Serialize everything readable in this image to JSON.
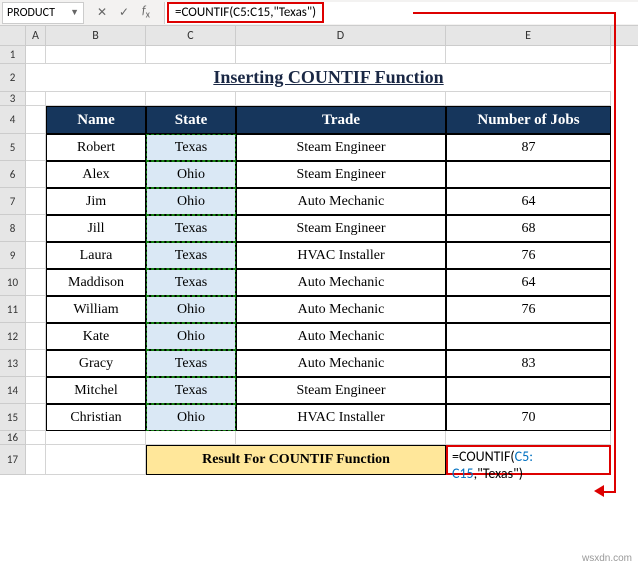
{
  "name_box": "PRODUCT",
  "formula_bar": "=COUNTIF(C5:C15,\"Texas\")",
  "columns": [
    "A",
    "B",
    "C",
    "D",
    "E"
  ],
  "row_numbers": [
    "1",
    "2",
    "3",
    "4",
    "5",
    "6",
    "7",
    "8",
    "9",
    "10",
    "11",
    "12",
    "13",
    "14",
    "15",
    "16",
    "17"
  ],
  "title": "Inserting COUNTIF Function",
  "headers": {
    "name": "Name",
    "state": "State",
    "trade": "Trade",
    "jobs": "Number of Jobs"
  },
  "rows": [
    {
      "name": "Robert",
      "state": "Texas",
      "trade": "Steam Engineer",
      "jobs": "87"
    },
    {
      "name": "Alex",
      "state": "Ohio",
      "trade": "Steam Engineer",
      "jobs": ""
    },
    {
      "name": "Jim",
      "state": "Ohio",
      "trade": "Auto Mechanic",
      "jobs": "64"
    },
    {
      "name": "Jill",
      "state": "Texas",
      "trade": "Steam Engineer",
      "jobs": "68"
    },
    {
      "name": "Laura",
      "state": "Texas",
      "trade": "HVAC Installer",
      "jobs": "76"
    },
    {
      "name": "Maddison",
      "state": "Texas",
      "trade": "Auto Mechanic",
      "jobs": "64"
    },
    {
      "name": "William",
      "state": "Ohio",
      "trade": "Auto Mechanic",
      "jobs": "76"
    },
    {
      "name": "Kate",
      "state": "Ohio",
      "trade": "Auto Mechanic",
      "jobs": ""
    },
    {
      "name": "Gracy",
      "state": "Texas",
      "trade": "Auto Mechanic",
      "jobs": "83"
    },
    {
      "name": "Mitchel",
      "state": "Texas",
      "trade": "Steam Engineer",
      "jobs": ""
    },
    {
      "name": "Christian",
      "state": "Ohio",
      "trade": "HVAC Installer",
      "jobs": "70"
    }
  ],
  "result_label": "Result For COUNTIF Function",
  "editing_formula": {
    "prefix": "=COUNTIF(",
    "ref": "C5:",
    "ref2": "C15",
    "suffix": ",\"Texas\")"
  },
  "watermark": "wsxdn.com"
}
